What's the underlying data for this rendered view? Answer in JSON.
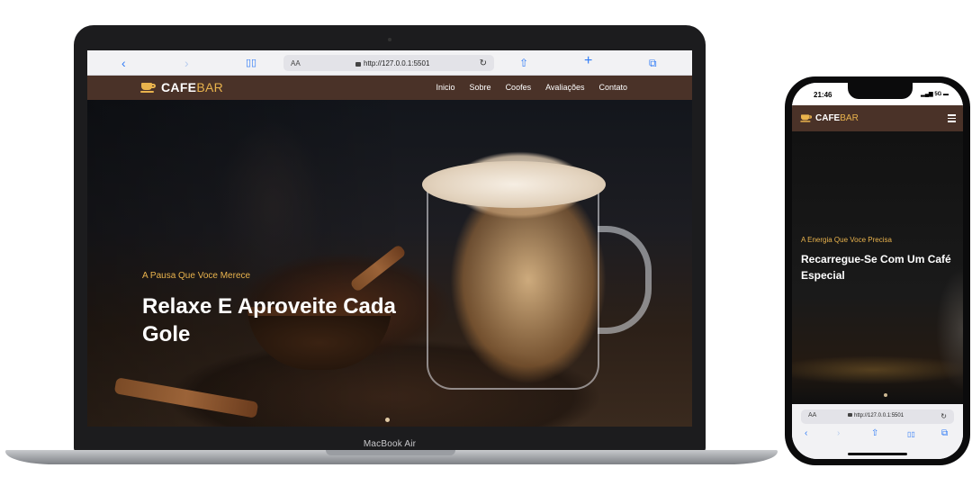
{
  "laptop": {
    "model_label": "MacBook Air",
    "browser": {
      "back_icon": "‹",
      "forward_icon": "›",
      "reader_icon": "📖",
      "text_size": "AA",
      "url": "http://127.0.0.1:5501",
      "reload_icon": "↻",
      "share_icon": "⇧",
      "new_tab_icon": "+",
      "tabs_icon": "⧉"
    },
    "site": {
      "brand_main": "CAFE",
      "brand_accent": "BAR",
      "nav": [
        "Inicio",
        "Sobre",
        "Coofes",
        "Avaliações",
        "Contato"
      ],
      "hero_tagline": "A Pausa Que Voce Merece",
      "hero_headline": "Relaxe E Aproveite Cada Gole"
    }
  },
  "phone": {
    "time": "21:46",
    "signal": "5G",
    "site": {
      "brand_main": "CAFE",
      "brand_accent": "BAR",
      "hero_tagline": "A Energia Que Voce Precisa",
      "hero_headline": "Recarregue-Se Com Um Café Especial"
    },
    "browser": {
      "text_size": "AA",
      "url": "http://127.0.0.1:5501",
      "reload_icon": "↻",
      "back_icon": "‹",
      "forward_icon": "›",
      "share_icon": "⇧",
      "reader_icon": "📖",
      "tabs_icon": "⧉"
    }
  },
  "colors": {
    "nav_bg": "#4a3228",
    "accent": "#e9b34d",
    "browser_accent": "#2f7bf6"
  }
}
